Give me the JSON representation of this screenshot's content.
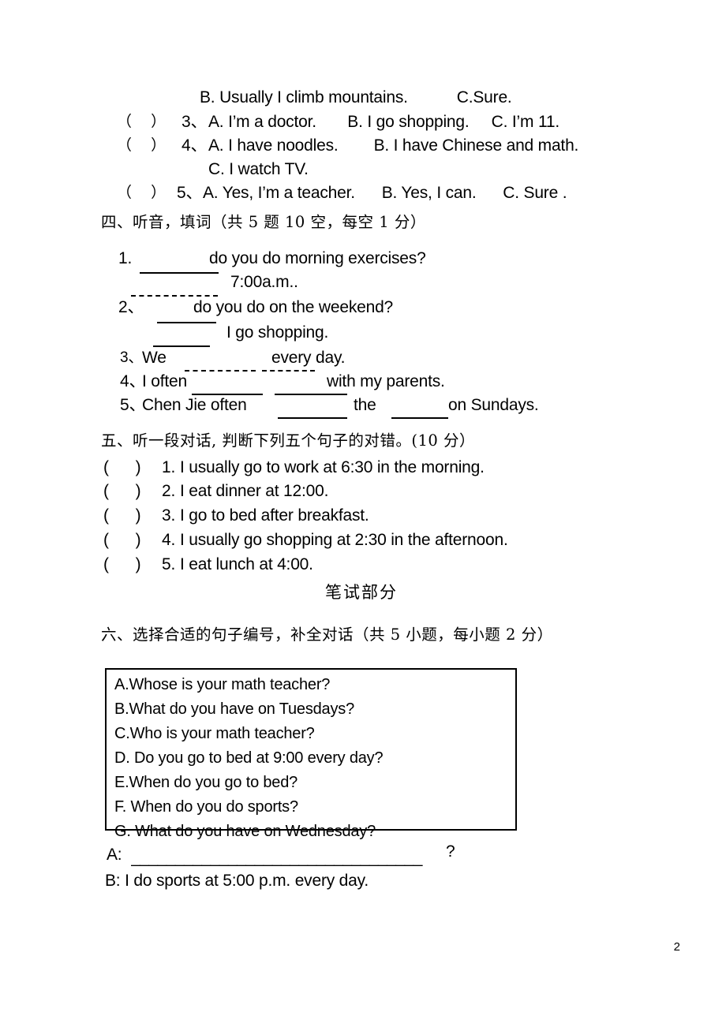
{
  "page": {
    "number": "2"
  },
  "listening_choices_continued": {
    "line_b_of_q2": "B. Usually I climb mountains.           C.Sure.",
    "items": [
      {
        "paren": "（    ）",
        "number": "3、",
        "text": "A. I’m a doctor.       B. I go shopping.     C. I’m 11."
      },
      {
        "paren": "（    ）",
        "number": "4、",
        "text": "A. I have noodles.        B. I have Chinese and math."
      },
      {
        "paren": "",
        "number": "",
        "text": "C. I watch TV."
      },
      {
        "paren": "（    ）",
        "number": "5、",
        "text": "A. Yes, I’m a teacher.      B. Yes, I can.      C. Sure ."
      }
    ]
  },
  "section_four": {
    "heading": "四、听音，填词（共 5 题 10 空，每空 1 分）",
    "items": [
      {
        "number": "1.",
        "text_a": "do you do morning exercises?",
        "text_b": "7:00a.m.."
      },
      {
        "number": "2、",
        "text_a": "do you do on the weekend?",
        "text_b": "I go shopping."
      },
      {
        "number": "3、",
        "text_a": "We",
        "text_b": "every day."
      },
      {
        "number": "4、",
        "text_a": "I often",
        "text_b": "with my parents."
      },
      {
        "number": "5、",
        "text_a": "Chen Jie often",
        "text_b": "the",
        "text_c": "on Sundays."
      }
    ]
  },
  "section_five": {
    "heading": "五、听一段对话, 判断下列五个句子的对错。(10 分）",
    "items": [
      {
        "paren": "(      )",
        "number": "1.",
        "text": "I usually go to work at 6:30 in the morning."
      },
      {
        "paren": "(      )",
        "number": "2.",
        "text": "I eat dinner at 12:00."
      },
      {
        "paren": "(      )",
        "number": "3.",
        "text": "I go to bed after breakfast."
      },
      {
        "paren": "(      )",
        "number": "4.",
        "text": "I usually go shopping at 2:30 in the afternoon."
      },
      {
        "paren": "(      )",
        "number": "5.",
        "text": "I eat lunch at 4:00."
      }
    ]
  },
  "written_part": {
    "title": "笔试部分"
  },
  "section_six": {
    "heading": "六、选择合适的句子编号，补全对话（共 5 小题，每小题 2 分）",
    "options": [
      "A.Whose is your math teacher?",
      "B.What do you have on Tuesdays?",
      "C.Who is your math teacher?",
      "D. Do you go to bed at 9:00 every day?",
      "E.When do you go to bed?",
      "F. When do you do sports?",
      "G. What do you have on Wednesday?"
    ],
    "dialogue": {
      "a_label": "A:",
      "a_blank": "_________________________________",
      "a_question_mark": "?",
      "b_line": "B: I do sports at 5:00 p.m. every day."
    }
  }
}
